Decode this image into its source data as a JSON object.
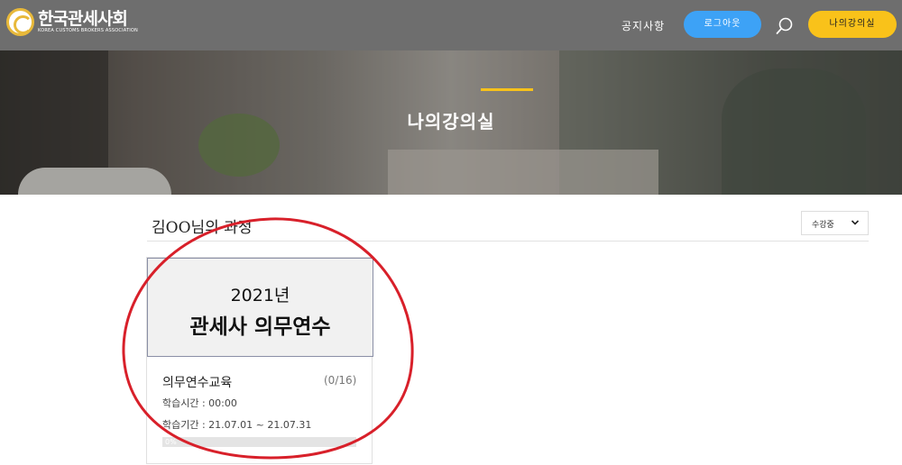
{
  "header": {
    "logo_title": "한국관세사회",
    "logo_subtitle": "KOREA CUSTOMS BROKERS ASSOCIATION",
    "nav_notice": "공지사항",
    "logout_label": "로그아웃",
    "myclass_label": "나의강의실"
  },
  "banner": {
    "title": "나의강의실"
  },
  "courses": {
    "section_title": "김OO님의 과정",
    "filter": {
      "selected": "수강중"
    },
    "items": [
      {
        "thumb_year": "2021년",
        "thumb_name": "관세사 의무연수",
        "name": "의무연수교육",
        "count": "(0/16)",
        "study_time": "학습시간 : 00:00",
        "study_period": "학습기간 : 21.07.01 ~ 21.07.31",
        "progress_label": "0%",
        "progress": 0
      }
    ]
  },
  "colors": {
    "header_bg": "#6e6e6e",
    "logout_button": "#3da2f6",
    "myclass_button": "#f9c21a",
    "banner_accent": "#f9c21a",
    "annotation": "#d8202a"
  }
}
